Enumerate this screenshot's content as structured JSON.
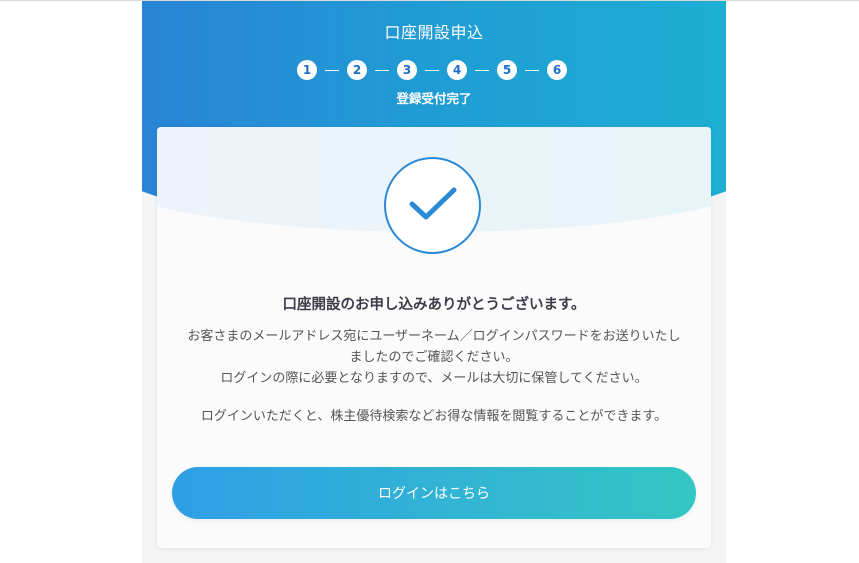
{
  "header": {
    "title": "口座開設申込",
    "steps": [
      "1",
      "2",
      "3",
      "4",
      "5",
      "6"
    ],
    "step_caption": "登録受付完了"
  },
  "card": {
    "check_icon": "checkmark-icon",
    "heading": "口座開設のお申し込みありがとうございます。",
    "message_line1": "お客さまのメールアドレス宛にユーザーネーム／ログインパスワードをお送りいたしましたのでご確認ください。",
    "message_line2": "ログインの際に必要となりますので、メールは大切に保管してください。",
    "message_line3": "ログインいただくと、株主優待検索などお得な情報を閲覧することができます。",
    "login_button_label": "ログインはこちら"
  },
  "colors": {
    "header_gradient_start": "#2a7fd6",
    "header_gradient_end": "#1cb2d3",
    "button_gradient_start": "#2f9fe6",
    "button_gradient_end": "#34c6c4",
    "check_color": "#2b8ad6"
  }
}
